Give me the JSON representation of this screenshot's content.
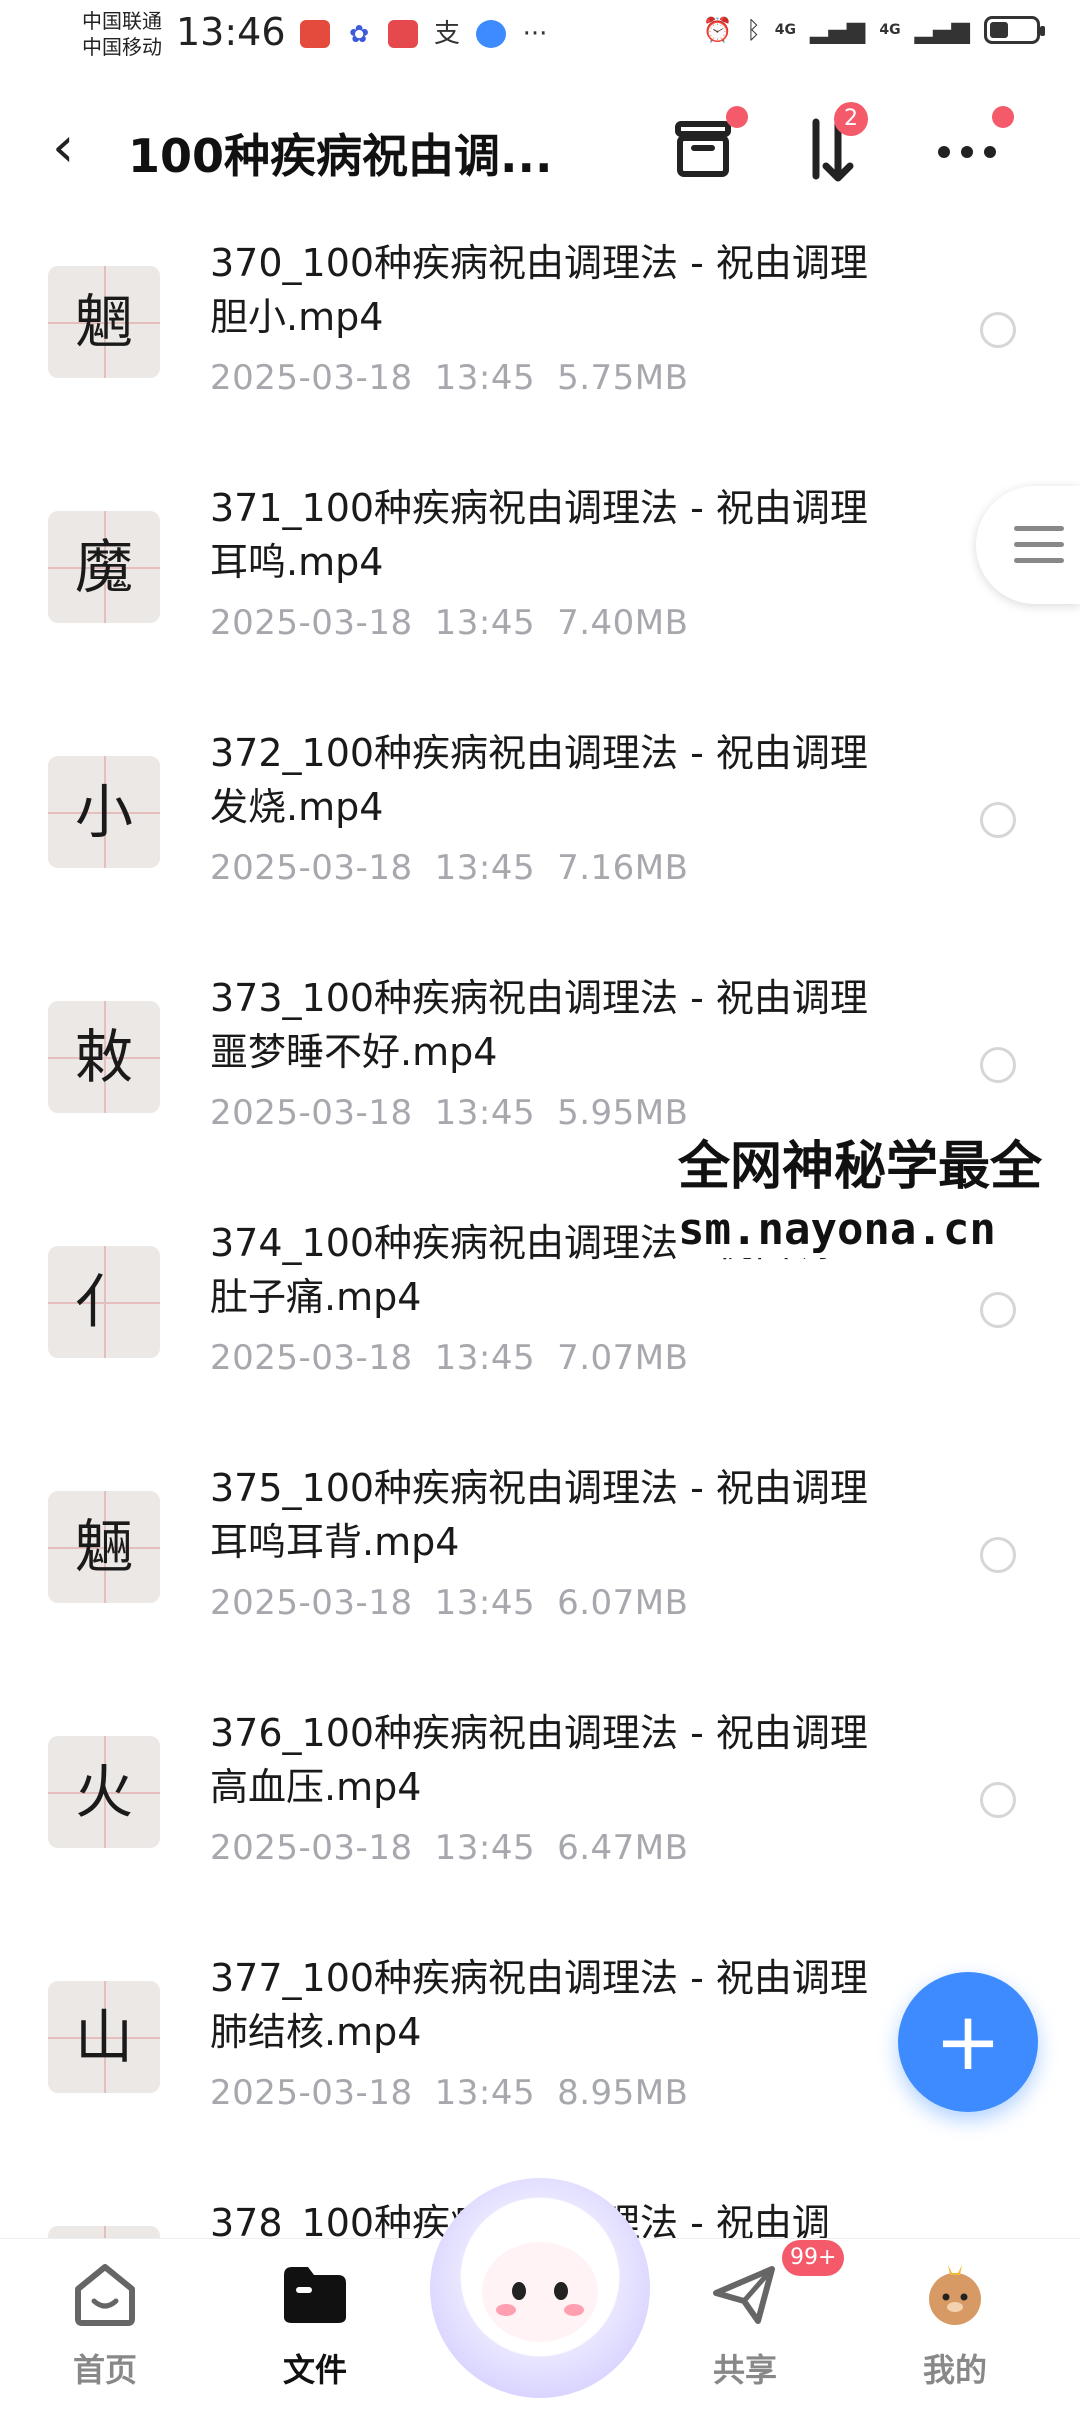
{
  "status_bar": {
    "carrier1": "中国联通",
    "carrier2": "中国移动",
    "time": "13:46",
    "network1": "4G",
    "network2": "4G",
    "battery_level": 0.4
  },
  "header": {
    "title": "100种疾病祝由调...",
    "sort_badge": "2"
  },
  "files": [
    {
      "name": "370_100种疾病祝由调理法 - 祝由调理胆小.mp4",
      "date": "2025-03-18",
      "time": "13:45",
      "size": "5.75MB",
      "thumb_char": "魍"
    },
    {
      "name": "371_100种疾病祝由调理法 - 祝由调理耳鸣.mp4",
      "date": "2025-03-18",
      "time": "13:45",
      "size": "7.40MB",
      "thumb_char": "魔"
    },
    {
      "name": "372_100种疾病祝由调理法 - 祝由调理发烧.mp4",
      "date": "2025-03-18",
      "time": "13:45",
      "size": "7.16MB",
      "thumb_char": "小"
    },
    {
      "name": "373_100种疾病祝由调理法 - 祝由调理噩梦睡不好.mp4",
      "date": "2025-03-18",
      "time": "13:45",
      "size": "5.95MB",
      "thumb_char": "敕"
    },
    {
      "name": "374_100种疾病祝由调理法 - 祝由调理肚子痛.mp4",
      "date": "2025-03-18",
      "time": "13:45",
      "size": "7.07MB",
      "thumb_char": "亻"
    },
    {
      "name": "375_100种疾病祝由调理法 - 祝由调理耳鸣耳背.mp4",
      "date": "2025-03-18",
      "time": "13:45",
      "size": "6.07MB",
      "thumb_char": "魎"
    },
    {
      "name": "376_100种疾病祝由调理法 - 祝由调理高血压.mp4",
      "date": "2025-03-18",
      "time": "13:45",
      "size": "6.47MB",
      "thumb_char": "火"
    },
    {
      "name": "377_100种疾病祝由调理法 - 祝由调理肺结核.mp4",
      "date": "2025-03-18",
      "time": "13:45",
      "size": "8.95MB",
      "thumb_char": "山"
    },
    {
      "name": "378_100种疾病祝由调理法 - 祝由调",
      "date": "",
      "time": "",
      "size": "",
      "thumb_char": ""
    }
  ],
  "watermark": {
    "line1": "全网神秘学最全",
    "line2": "sm.nayona.cn"
  },
  "bottom_nav": {
    "home": "首页",
    "files": "文件",
    "share": "共享",
    "share_badge": "99+",
    "mine": "我的"
  }
}
